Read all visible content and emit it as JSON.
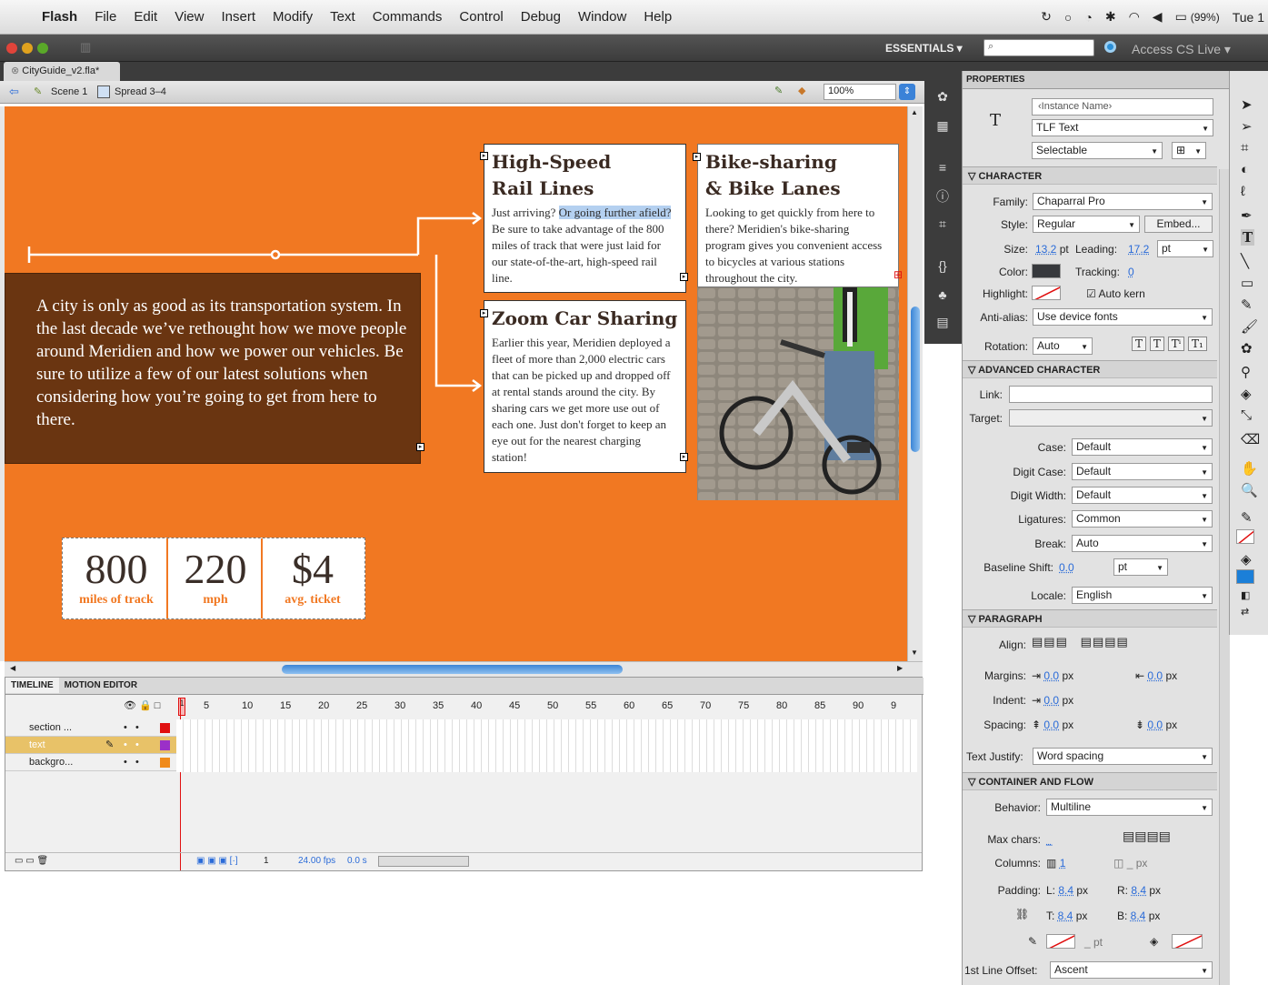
{
  "menubar": {
    "app": "Flash",
    "items": [
      "File",
      "Edit",
      "View",
      "Insert",
      "Modify",
      "Text",
      "Commands",
      "Control",
      "Debug",
      "Window",
      "Help"
    ],
    "battery": "(99%)",
    "clock": "Tue 1"
  },
  "toolbar": {
    "workspace": "ESSENTIALS ▾",
    "access": "Access CS Live ▾"
  },
  "document": {
    "tab": "CityGuide_v2.fla*",
    "scene": "Scene 1",
    "spread": "Spread 3–4",
    "zoom": "100%"
  },
  "stage": {
    "rail_title1": "High-Speed",
    "rail_title2": "Rail Lines",
    "rail_body_a": "Just arriving? ",
    "rail_body_sel": "Or going further afield?",
    "rail_body_b": " Be sure to take advantage of the 800 miles of track that were just laid for our state-of-the-art, high-speed rail line.",
    "bike_title1": "Bike-sharing",
    "bike_title2": "& Bike Lanes",
    "bike_body": "Looking to get quickly from here to there? Meridien's bike-sharing program gives you convenient access to bicycles at various stations throughout the city.",
    "zoom_title": "Zoom Car Sharing",
    "zoom_body": "Earlier this year, Meridien deployed a fleet of more than 2,000 electric cars that can be picked up and dropped off at rental stands around the city. By sharing cars we get more use out of each one. Just don't forget to keep an eye out for the nearest charging station!",
    "intro": "A city is only as good as its transportation system. In the last decade we’ve rethought how we move people around Meridien and how we power our vehicles. Be sure to utilize a few of our latest solutions when considering how you’re going to get from here to there.",
    "stats": [
      {
        "value": "800",
        "label": "miles of track"
      },
      {
        "value": "220",
        "label": "mph"
      },
      {
        "value": "$4",
        "label": "avg. ticket"
      }
    ]
  },
  "timeline": {
    "tabs": [
      "TIMELINE",
      "MOTION EDITOR"
    ],
    "frame_numbers": [
      "1",
      "5",
      "10",
      "15",
      "20",
      "25",
      "30",
      "35",
      "40",
      "45",
      "50",
      "55",
      "60",
      "65",
      "70",
      "75",
      "80",
      "85",
      "90",
      "9"
    ],
    "layers": [
      {
        "name": "section ...",
        "color": "#e01010"
      },
      {
        "name": "text",
        "color": "#9b30c8"
      },
      {
        "name": "backgro...",
        "color": "#f08a1a"
      }
    ],
    "current_frame": "1",
    "fps": "24.00 fps",
    "time": "0.0 s"
  },
  "properties": {
    "title": "PROPERTIES",
    "instance_placeholder": "‹Instance Name›",
    "text_type": "TLF Text",
    "selectability": "Selectable",
    "character_hdr": "CHARACTER",
    "family_label": "Family:",
    "family": "Chaparral Pro",
    "style_label": "Style:",
    "style": "Regular",
    "embed": "Embed...",
    "size_label": "Size:",
    "size": "13.2",
    "size_unit": "pt",
    "leading_label": "Leading:",
    "leading": "17.2",
    "leading_unit": "pt",
    "color_label": "Color:",
    "tracking_label": "Tracking:",
    "tracking": "0",
    "highlight_label": "Highlight:",
    "autokern": "Auto kern",
    "antialias_label": "Anti-alias:",
    "antialias": "Use device fonts",
    "rotation_label": "Rotation:",
    "rotation": "Auto",
    "advanced_hdr": "ADVANCED CHARACTER",
    "link_label": "Link:",
    "target_label": "Target:",
    "case_label": "Case:",
    "case": "Default",
    "digitcase_label": "Digit Case:",
    "digitcase": "Default",
    "digitwidth_label": "Digit Width:",
    "digitwidth": "Default",
    "ligatures_label": "Ligatures:",
    "ligatures": "Common",
    "break_label": "Break:",
    "break": "Auto",
    "baseline_label": "Baseline Shift:",
    "baseline": "0.0",
    "baseline_unit": "pt",
    "locale_label": "Locale:",
    "locale": "English",
    "paragraph_hdr": "PARAGRAPH",
    "align_label": "Align:",
    "margins_label": "Margins:",
    "margin_left": "0.0",
    "margin_right": "0.0",
    "px": "px",
    "indent_label": "Indent:",
    "indent": "0.0",
    "spacing_label": "Spacing:",
    "spacing_before": "0.0",
    "spacing_after": "0.0",
    "justify_label": "Text Justify:",
    "justify": "Word spacing",
    "container_hdr": "CONTAINER AND FLOW",
    "behavior_label": "Behavior:",
    "behavior": "Multiline",
    "maxchars_label": "Max chars:",
    "maxchars": "_",
    "columns_label": "Columns:",
    "columns": "1",
    "gutter": "_ px",
    "padding_label": "Padding:",
    "pad_l": "8.4",
    "pad_r": "8.4",
    "pad_t": "8.4",
    "pad_b": "8.4",
    "stroke_pt": "_ pt",
    "firstline_label": "1st Line Offset:",
    "firstline": "Ascent"
  }
}
